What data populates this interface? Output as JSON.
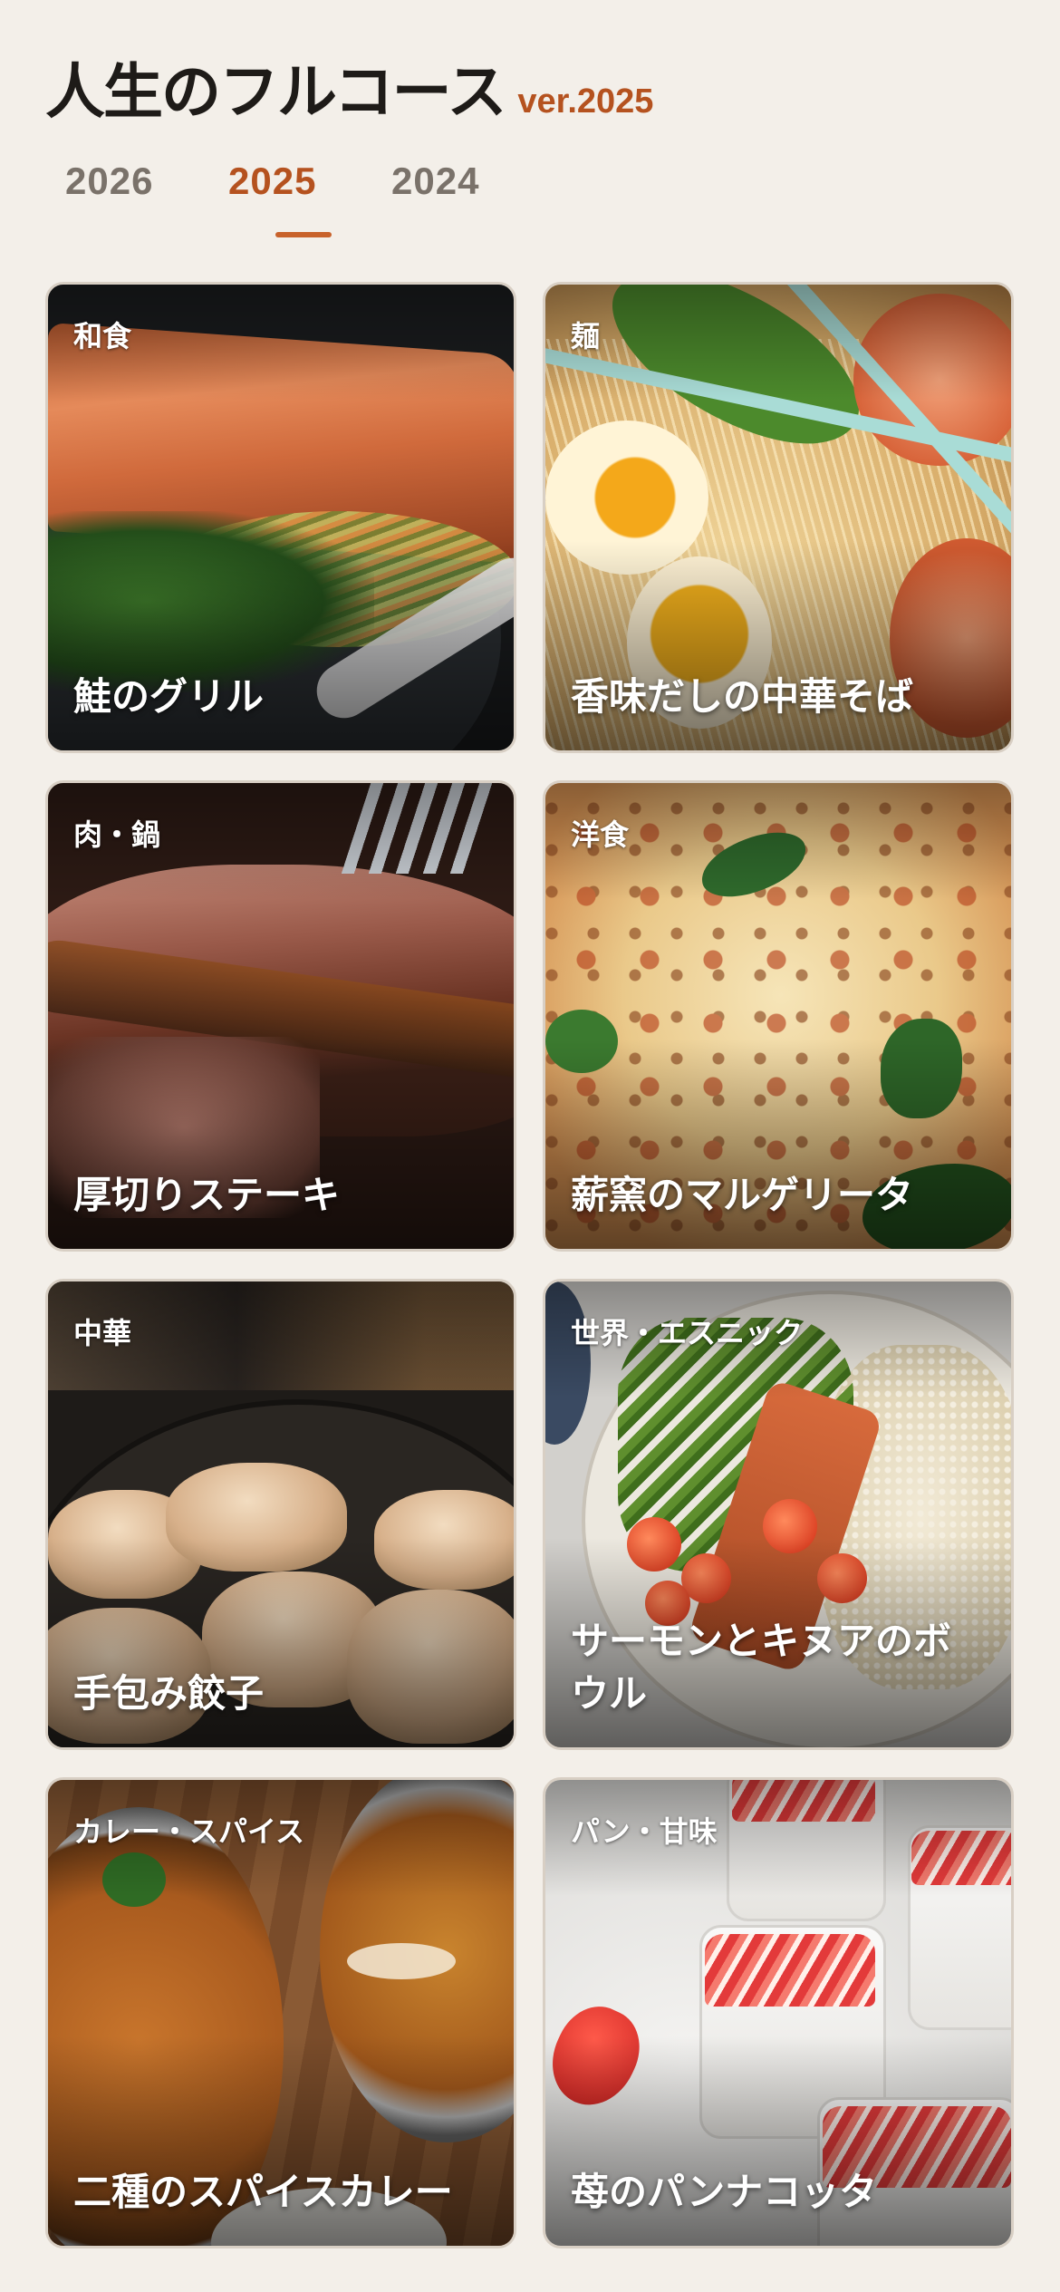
{
  "header": {
    "title": "人生のフルコース",
    "version": "ver.2025"
  },
  "tabs": [
    {
      "label": "2026",
      "active": false
    },
    {
      "label": "2025",
      "active": true
    },
    {
      "label": "2024",
      "active": false
    }
  ],
  "colors": {
    "accent": "#b5521f",
    "background": "#f3efe9"
  },
  "cards": [
    {
      "category": "和食",
      "name": "鮭のグリル"
    },
    {
      "category": "麺",
      "name": "香味だしの中華そば"
    },
    {
      "category": "肉・鍋",
      "name": "厚切りステーキ"
    },
    {
      "category": "洋食",
      "name": "薪窯のマルゲリータ"
    },
    {
      "category": "中華",
      "name": "手包み餃子"
    },
    {
      "category": "世界・エスニック",
      "name": "サーモンとキヌアのボウル"
    },
    {
      "category": "カレー・スパイス",
      "name": "二種のスパイスカレー"
    },
    {
      "category": "パン・甘味",
      "name": "苺のパンナコッタ"
    }
  ]
}
